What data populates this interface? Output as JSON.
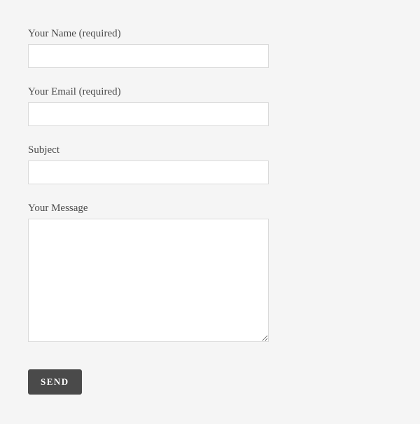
{
  "form": {
    "name": {
      "label": "Your Name (required)",
      "value": ""
    },
    "email": {
      "label": "Your Email (required)",
      "value": ""
    },
    "subject": {
      "label": "Subject",
      "value": ""
    },
    "message": {
      "label": "Your Message",
      "value": ""
    },
    "submit_label": "SEND"
  }
}
